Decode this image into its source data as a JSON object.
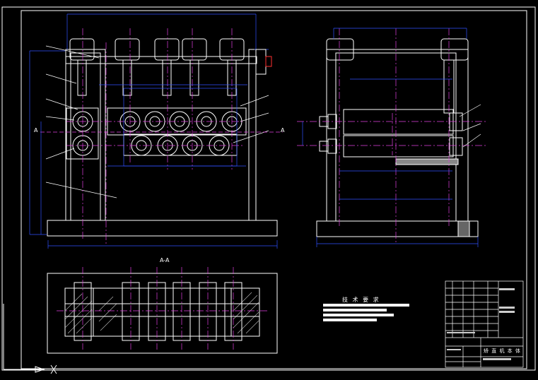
{
  "drawing": {
    "section_label": "A-A",
    "section_marker": "A",
    "tech_requirements_title": "技 术 要 求",
    "title_block_name": "矫 直 机 本 体"
  }
}
